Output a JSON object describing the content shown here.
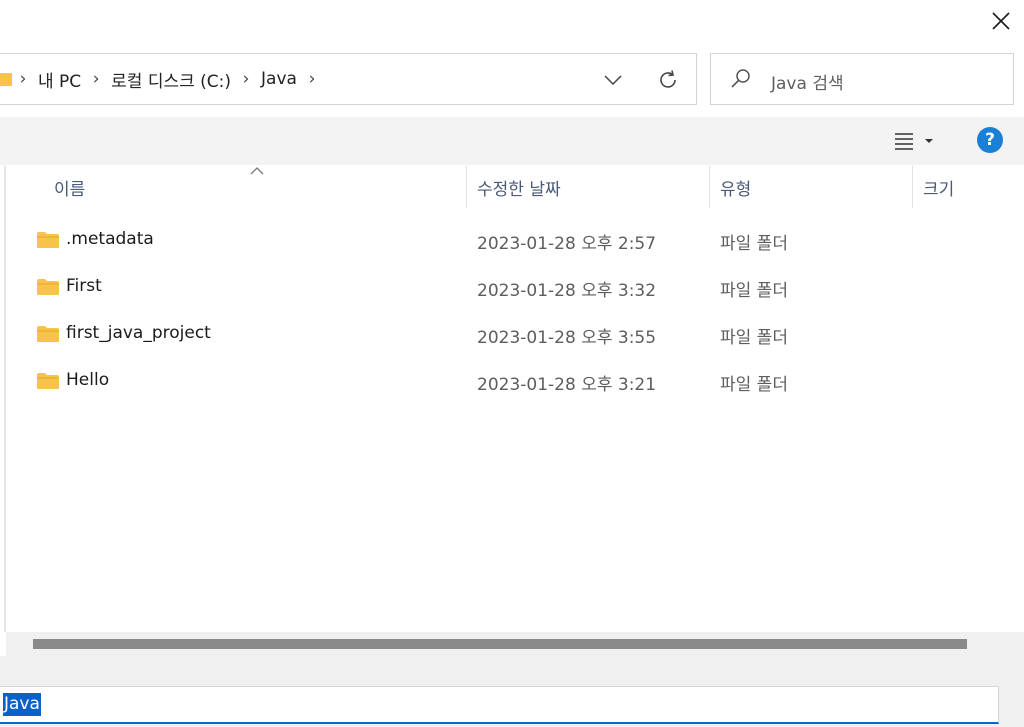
{
  "window": {
    "close_icon": "close-icon"
  },
  "address": {
    "root_icon": "folder-icon",
    "crumbs": [
      "내 PC",
      "로컬 디스크 (C:)",
      "Java"
    ],
    "dropdown_icon": "chevron-down-icon",
    "refresh_icon": "refresh-icon"
  },
  "search": {
    "placeholder": "Java 검색",
    "icon": "search-icon"
  },
  "toolbar": {
    "view_icon": "view-options-icon",
    "help_label": "?"
  },
  "columns": {
    "name": "이름",
    "date": "수정한 날짜",
    "type": "유형",
    "size": "크기"
  },
  "files": [
    {
      "name": ".metadata",
      "date": "2023-01-28 오후 2:57",
      "type": "파일 폴더"
    },
    {
      "name": "First",
      "date": "2023-01-28 오후 3:32",
      "type": "파일 폴더"
    },
    {
      "name": "first_java_project",
      "date": "2023-01-28 오후 3:55",
      "type": "파일 폴더"
    },
    {
      "name": "Hello",
      "date": "2023-01-28 오후 3:21",
      "type": "파일 폴더"
    }
  ],
  "filename": {
    "value": "Java"
  },
  "colors": {
    "accent": "#0b61c9",
    "folder": "#f7c34a",
    "help": "#1a7fd6"
  }
}
